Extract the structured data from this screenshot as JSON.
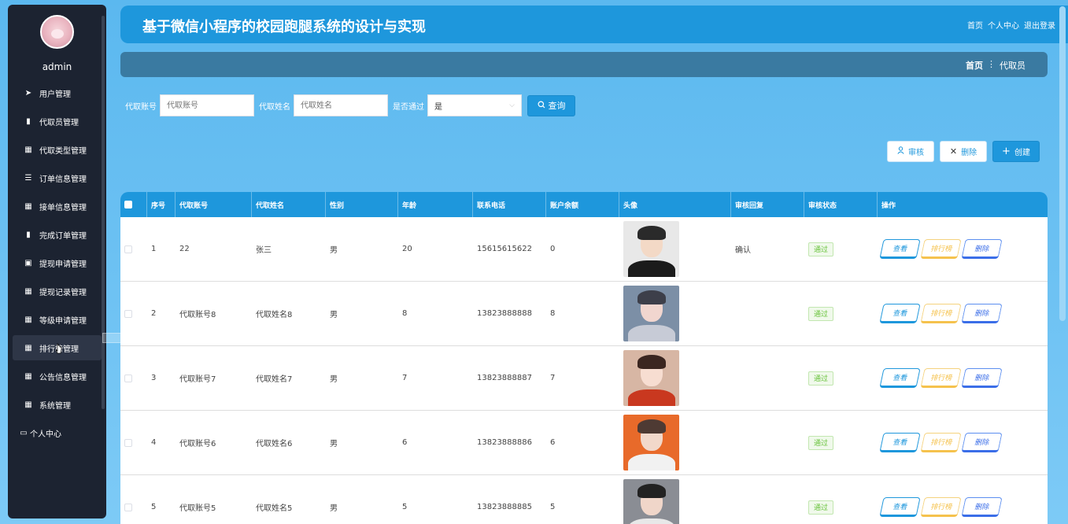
{
  "app": {
    "title": "基于微信小程序的校园跑腿系统的设计与实现",
    "header_links": [
      "首页",
      "个人中心",
      "退出登录"
    ]
  },
  "sidebar": {
    "username": "admin",
    "items": [
      {
        "label": "用户管理",
        "icon": "send-icon",
        "glyph": "➤"
      },
      {
        "label": "代取员管理",
        "icon": "book-icon",
        "glyph": "▮"
      },
      {
        "label": "代取类型管理",
        "icon": "grid-icon",
        "glyph": "▦"
      },
      {
        "label": "订单信息管理",
        "icon": "sliders-icon",
        "glyph": "☰"
      },
      {
        "label": "接单信息管理",
        "icon": "grid-icon",
        "glyph": "▦"
      },
      {
        "label": "完成订单管理",
        "icon": "bar-chart-icon",
        "glyph": "▮"
      },
      {
        "label": "提现申请管理",
        "icon": "clipboard-icon",
        "glyph": "▣"
      },
      {
        "label": "提现记录管理",
        "icon": "grid-icon",
        "glyph": "▦"
      },
      {
        "label": "等级申请管理",
        "icon": "grid-icon",
        "glyph": "▦"
      },
      {
        "label": "排行榜管理",
        "icon": "grid-icon",
        "glyph": "▦"
      },
      {
        "label": "公告信息管理",
        "icon": "grid-icon",
        "glyph": "▦"
      },
      {
        "label": "系统管理",
        "icon": "grid-icon",
        "glyph": "▦"
      },
      {
        "label": "个人中心",
        "icon": "id-card-icon",
        "glyph": "▭"
      }
    ]
  },
  "breadcrumb": {
    "home": "首页",
    "separator": "⋮",
    "current": "代取员"
  },
  "search": {
    "account_label": "代取账号",
    "account_placeholder": "代取账号",
    "name_label": "代取姓名",
    "name_placeholder": "代取姓名",
    "passed_label": "是否通过",
    "passed_value": "是",
    "query_label": "查询"
  },
  "actions": {
    "audit": "审核",
    "delete": "删除",
    "create": "创建"
  },
  "table": {
    "headers": [
      "序号",
      "代取账号",
      "代取姓名",
      "性别",
      "年龄",
      "联系电话",
      "账户余额",
      "头像",
      "审核回复",
      "审核状态",
      "操作"
    ],
    "rows": [
      {
        "index": "1",
        "account": "22",
        "name": "张三",
        "gender": "男",
        "age": "20",
        "phone": "15615615622",
        "balance": "0",
        "reply": "确认",
        "status": "通过"
      },
      {
        "index": "2",
        "account": "代取账号8",
        "name": "代取姓名8",
        "gender": "男",
        "age": "8",
        "phone": "13823888888",
        "balance": "8",
        "reply": "",
        "status": "通过"
      },
      {
        "index": "3",
        "account": "代取账号7",
        "name": "代取姓名7",
        "gender": "男",
        "age": "7",
        "phone": "13823888887",
        "balance": "7",
        "reply": "",
        "status": "通过"
      },
      {
        "index": "4",
        "account": "代取账号6",
        "name": "代取姓名6",
        "gender": "男",
        "age": "6",
        "phone": "13823888886",
        "balance": "6",
        "reply": "",
        "status": "通过"
      },
      {
        "index": "5",
        "account": "代取账号5",
        "name": "代取姓名5",
        "gender": "男",
        "age": "5",
        "phone": "13823888885",
        "balance": "5",
        "reply": "",
        "status": "通过"
      }
    ],
    "ops": {
      "view": "查看",
      "rank": "排行榜",
      "delete": "删除"
    }
  },
  "colors": {
    "primary": "#1e97dc",
    "sidebar": "#1c2331",
    "success": "#67c23a"
  }
}
